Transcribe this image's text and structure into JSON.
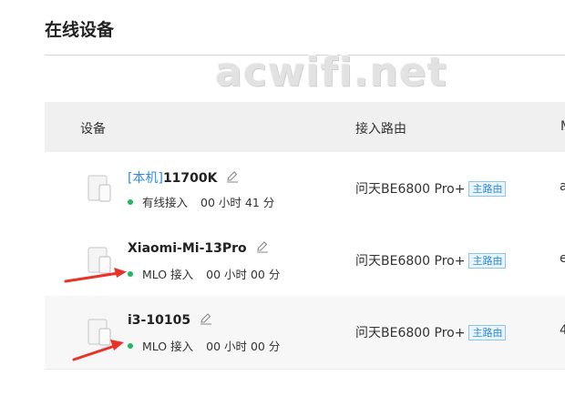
{
  "page": {
    "title": "在线设备"
  },
  "watermark": "acwifi.net",
  "table": {
    "headers": {
      "device": "设备",
      "router": "接入路由",
      "next": "M"
    },
    "rows": [
      {
        "local_tag": "[本机]",
        "name": "11700K",
        "connection": "有线接入",
        "duration": "00 小时 41 分",
        "router": "问天BE6800 Pro+",
        "router_badge": "主路由",
        "next_col": "a"
      },
      {
        "local_tag": "",
        "name": "Xiaomi-Mi-13Pro",
        "connection": "MLO 接入",
        "duration": "00 小时 00 分",
        "router": "问天BE6800 Pro+",
        "router_badge": "主路由",
        "next_col": "e"
      },
      {
        "local_tag": "",
        "name": "i3-10105",
        "connection": "MLO 接入",
        "duration": "00 小时 00 分",
        "router": "问天BE6800 Pro+",
        "router_badge": "主路由",
        "next_col": "4"
      }
    ]
  },
  "colors": {
    "accent": "#2d8ce0",
    "online_dot": "#1eb85e",
    "arrow": "#e8332a",
    "header_bg": "#f0f0f0"
  },
  "icons": {
    "device": "device-icon",
    "edit": "pencil-icon",
    "status": "online-dot-icon"
  }
}
